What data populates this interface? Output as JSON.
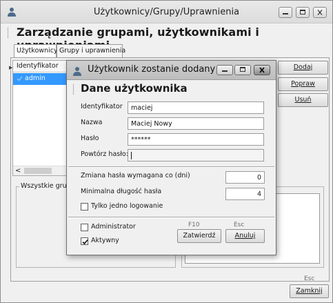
{
  "window": {
    "title": "Użytkownicy/Grupy/Uprawnienia",
    "heading": "Zarządzanie grupami, użytkownikami i uprawnieniami"
  },
  "tabs": [
    {
      "label": "Użytkownicy",
      "active": true
    },
    {
      "label": "Grupy i uprawnienia",
      "active": false
    }
  ],
  "users_grid": {
    "column_header": "Identyfikator",
    "rows": [
      {
        "name": "admin",
        "selected": true
      }
    ]
  },
  "side_buttons": {
    "add": "Dodaj",
    "edit": "Popraw",
    "delete": "Usuń"
  },
  "groups_box": {
    "label": "Wszystkie grup"
  },
  "footer": {
    "close_hint": "Esc",
    "close": "Zamknij"
  },
  "dialog": {
    "title": "Użytkownik zostanie dodany",
    "heading": "Dane użytkownika",
    "fields": {
      "identifier": {
        "label": "Identyfikator",
        "value": "maciej"
      },
      "name": {
        "label": "Nazwa",
        "value": "Maciej Nowy"
      },
      "password": {
        "label": "Hasło",
        "value": "******"
      },
      "repeat_password": {
        "label": "Powtórz hasło:",
        "value": ""
      }
    },
    "password_change_days": {
      "label": "Zmiana hasła wymagana co (dni)",
      "value": "0"
    },
    "min_password_length": {
      "label": "Minimalna długość hasła",
      "value": "4"
    },
    "single_login": {
      "label": "Tylko jedno logowanie",
      "checked": false
    },
    "administrator": {
      "label": "Administrator",
      "checked": false
    },
    "active": {
      "label": "Aktywny",
      "checked": true
    },
    "confirm_hint": "F10",
    "confirm": "Zatwierdź",
    "cancel_hint": "Esc",
    "cancel": "Anuluj"
  },
  "colors": {
    "selection": "#3399ff",
    "window_bg": "#f0f0f0"
  }
}
